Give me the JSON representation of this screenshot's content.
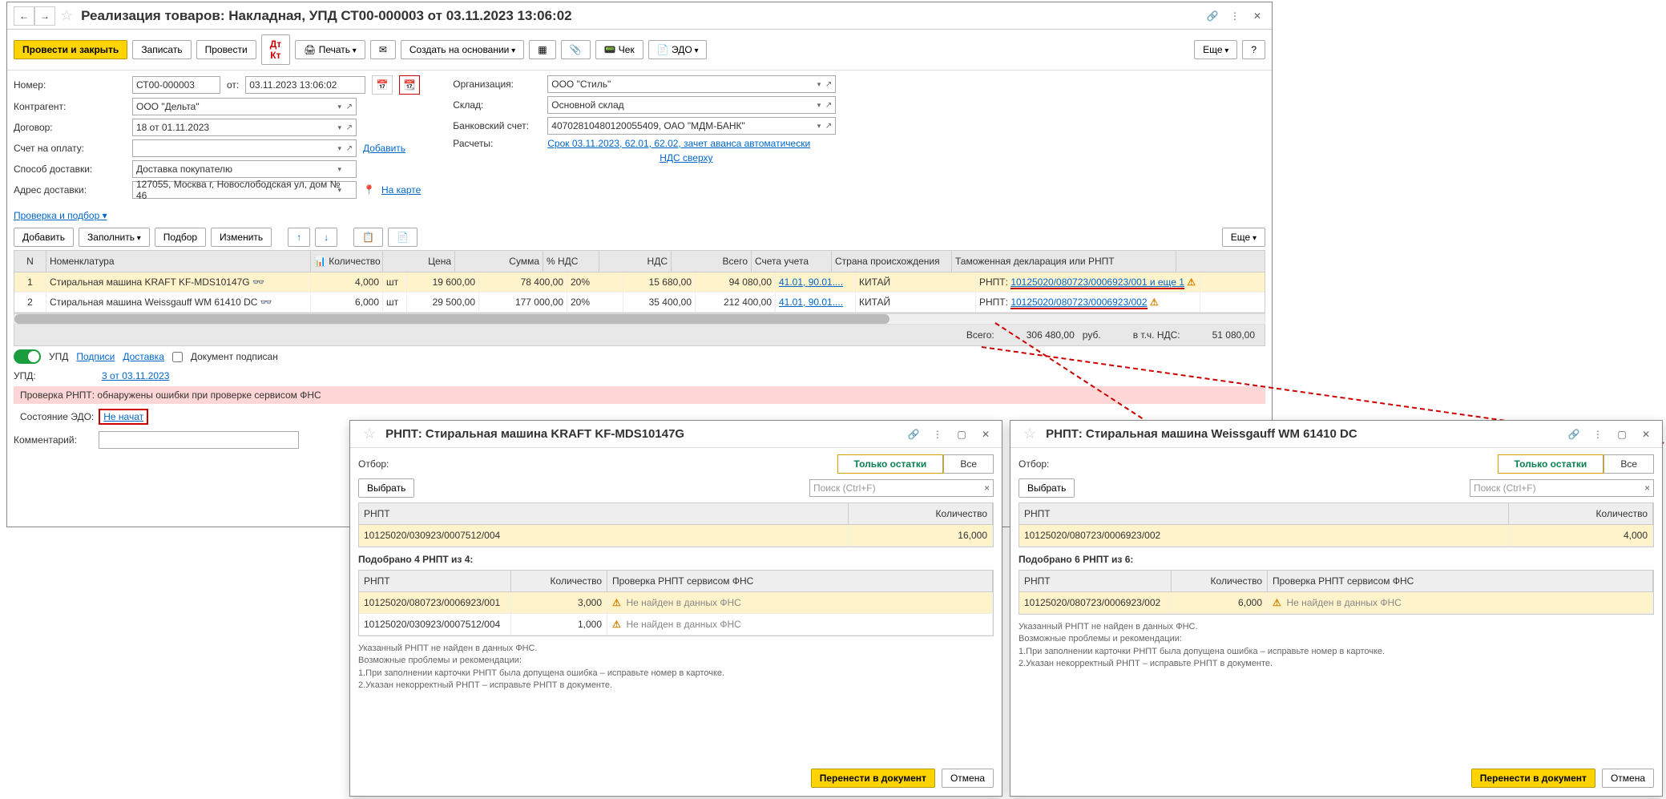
{
  "main": {
    "title": "Реализация товаров: Накладная, УПД СТ00-000003 от 03.11.2023 13:06:02",
    "toolbar": {
      "post_close": "Провести и закрыть",
      "write": "Записать",
      "post": "Провести",
      "print": "Печать",
      "create_based": "Создать на основании",
      "cheque": "Чек",
      "edo": "ЭДО",
      "more": "Еще",
      "help": "?"
    },
    "form": {
      "number_label": "Номер:",
      "number": "СТ00-000003",
      "from_label": "от:",
      "date": "03.11.2023 13:06:02",
      "contragent_label": "Контрагент:",
      "contragent": "ООО \"Дельта\"",
      "contract_label": "Договор:",
      "contract": "18 от 01.11.2023",
      "payacct_label": "Счет на оплату:",
      "add_link": "Добавить",
      "delivery_label": "Способ доставки:",
      "delivery": "Доставка покупателю",
      "address_label": "Адрес доставки:",
      "address": "127055, Москва г, Новослободская ул, дом № 46",
      "map_link": "На карте",
      "org_label": "Организация:",
      "org": "ООО \"Стиль\"",
      "warehouse_label": "Склад:",
      "warehouse": "Основной склад",
      "bank_label": "Банковский счет:",
      "bank": "40702810480120055409, ОАО \"МДМ-БАНК\"",
      "calc_label": "Расчеты:",
      "calc_link": "Срок 03.11.2023, 62.01, 62.02, зачет аванса автоматически",
      "vat_link": "НДС сверху"
    },
    "check_pickup": "Проверка и подбор",
    "table_toolbar": {
      "add": "Добавить",
      "fill": "Заполнить",
      "pick": "Подбор",
      "change": "Изменить",
      "more": "Еще"
    },
    "columns": {
      "n": "N",
      "nom": "Номенклатура",
      "qty": "Количество",
      "price": "Цена",
      "sum": "Сумма",
      "vatp": "% НДС",
      "vat": "НДС",
      "total": "Всего",
      "acct": "Счета учета",
      "country": "Страна происхождения",
      "decl": "Таможенная декларация или РНПТ"
    },
    "rows": [
      {
        "n": "1",
        "nom": "Стиральная машина KRAFT KF-MDS10147G",
        "qty": "4,000",
        "unit": "шт",
        "price": "19 600,00",
        "sum": "78 400,00",
        "vatp": "20%",
        "vat": "15 680,00",
        "total": "94 080,00",
        "acct": "41.01, 90.01....",
        "country": "КИТАЙ",
        "decl_label": "РНПТ:",
        "decl": "10125020/080723/0006923/001 и еще 1"
      },
      {
        "n": "2",
        "nom": "Стиральная машина Weissgauff WM 61410 DC",
        "qty": "6,000",
        "unit": "шт",
        "price": "29 500,00",
        "sum": "177 000,00",
        "vatp": "20%",
        "vat": "35 400,00",
        "total": "212 400,00",
        "acct": "41.01, 90.01....",
        "country": "КИТАЙ",
        "decl_label": "РНПТ:",
        "decl": "10125020/080723/0006923/002"
      }
    ],
    "totals": {
      "total_label": "Всего:",
      "total": "306 480,00",
      "currency": "руб.",
      "vat_label": "в т.ч. НДС:",
      "vat": "51 080,00"
    },
    "status": {
      "upd": "УПД",
      "signatures": "Подписи",
      "delivery": "Доставка",
      "doc_signed": "Документ подписан"
    },
    "upd": {
      "label": "УПД:",
      "value": "3 от 03.11.2023"
    },
    "rnpt_check": {
      "label": "Проверка РНПТ:",
      "text": "обнаружены ошибки при проверке сервисом ФНС"
    },
    "edo_state": {
      "label": "Состояние ЭДО:",
      "value": "Не начат"
    },
    "comment": {
      "label": "Комментарий:"
    }
  },
  "popup1": {
    "title": "РНПТ: Стиральная машина KRAFT KF-MDS10147G",
    "filter_label": "Отбор:",
    "only_remains": "Только остатки",
    "all": "Все",
    "select": "Выбрать",
    "search_ph": "Поиск (Ctrl+F)",
    "col_rnpt": "РНПТ",
    "col_qty": "Количество",
    "top_rows": [
      {
        "rnpt": "10125020/030923/0007512/004",
        "qty": "16,000"
      }
    ],
    "picked_title": "Подобрано 4 РНПТ из 4:",
    "col_check": "Проверка РНПТ сервисом ФНС",
    "bottom_rows": [
      {
        "rnpt": "10125020/080723/0006923/001",
        "qty": "3,000",
        "msg": "Не найден в данных ФНС"
      },
      {
        "rnpt": "10125020/030923/0007512/004",
        "qty": "1,000",
        "msg": "Не найден в данных ФНС"
      }
    ],
    "note1": "Указанный РНПТ не найден в данных ФНС.",
    "note2": "Возможные проблемы и рекомендации:",
    "note3": "1.При заполнении карточки РНПТ была допущена ошибка – исправьте номер в карточке.",
    "note4": "2.Указан некорректный РНПТ – исправьте РНПТ в документе.",
    "transfer": "Перенести в документ",
    "cancel": "Отмена"
  },
  "popup2": {
    "title": "РНПТ: Стиральная машина Weissgauff WM 61410 DC",
    "filter_label": "Отбор:",
    "only_remains": "Только остатки",
    "all": "Все",
    "select": "Выбрать",
    "search_ph": "Поиск (Ctrl+F)",
    "col_rnpt": "РНПТ",
    "col_qty": "Количество",
    "top_rows": [
      {
        "rnpt": "10125020/080723/0006923/002",
        "qty": "4,000"
      }
    ],
    "picked_title": "Подобрано 6 РНПТ из 6:",
    "col_check": "Проверка РНПТ сервисом ФНС",
    "bottom_rows": [
      {
        "rnpt": "10125020/080723/0006923/002",
        "qty": "6,000",
        "msg": "Не найден в данных ФНС"
      }
    ],
    "note1": "Указанный РНПТ не найден в данных ФНС.",
    "note2": "Возможные проблемы и рекомендации:",
    "note3": "1.При заполнении карточки РНПТ была допущена ошибка – исправьте номер в карточке.",
    "note4": "2.Указан некорректный РНПТ – исправьте РНПТ в документе.",
    "transfer": "Перенести в документ",
    "cancel": "Отмена"
  }
}
